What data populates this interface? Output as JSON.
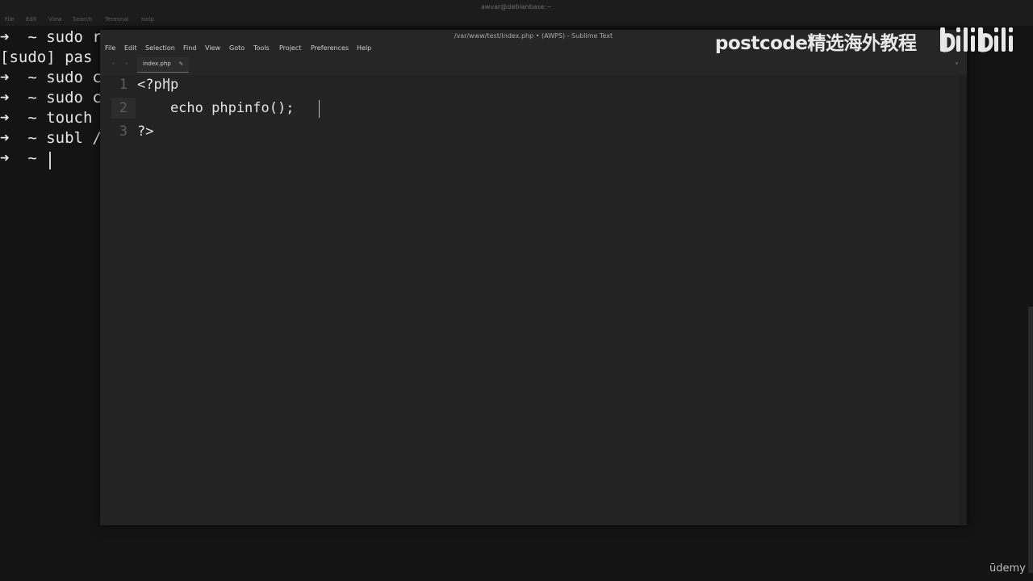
{
  "terminal": {
    "title": "awvar@debianbase:~",
    "menu": [
      "File",
      "Edit",
      "View",
      "Search",
      "Terminal",
      "Help"
    ],
    "lines": [
      "➜  ~ sudo r",
      "[sudo] pas",
      "➜  ~ sudo c",
      "➜  ~ sudo c",
      "➜  ~ touch",
      "➜  ~ subl /",
      "➜  ~ "
    ]
  },
  "sublime": {
    "title": "/var/www/test/index.php • (AWPS) - Sublime Text",
    "menu": [
      "File",
      "Edit",
      "Selection",
      "Find",
      "View",
      "Goto",
      "Tools",
      "Project",
      "Preferences",
      "Help"
    ],
    "nav_back": "‹",
    "nav_forward": "›",
    "dropdown": "▾",
    "tab": {
      "label": "index.php",
      "dirty_icon": "✎"
    },
    "line_numbers": [
      "1",
      "2",
      "3"
    ],
    "code": [
      "<?php",
      "    echo phpinfo();",
      "?>"
    ]
  },
  "overlay": {
    "watermark": "postcode精选海外教程",
    "logo": "bilibili",
    "udemy": "ūdemy"
  }
}
